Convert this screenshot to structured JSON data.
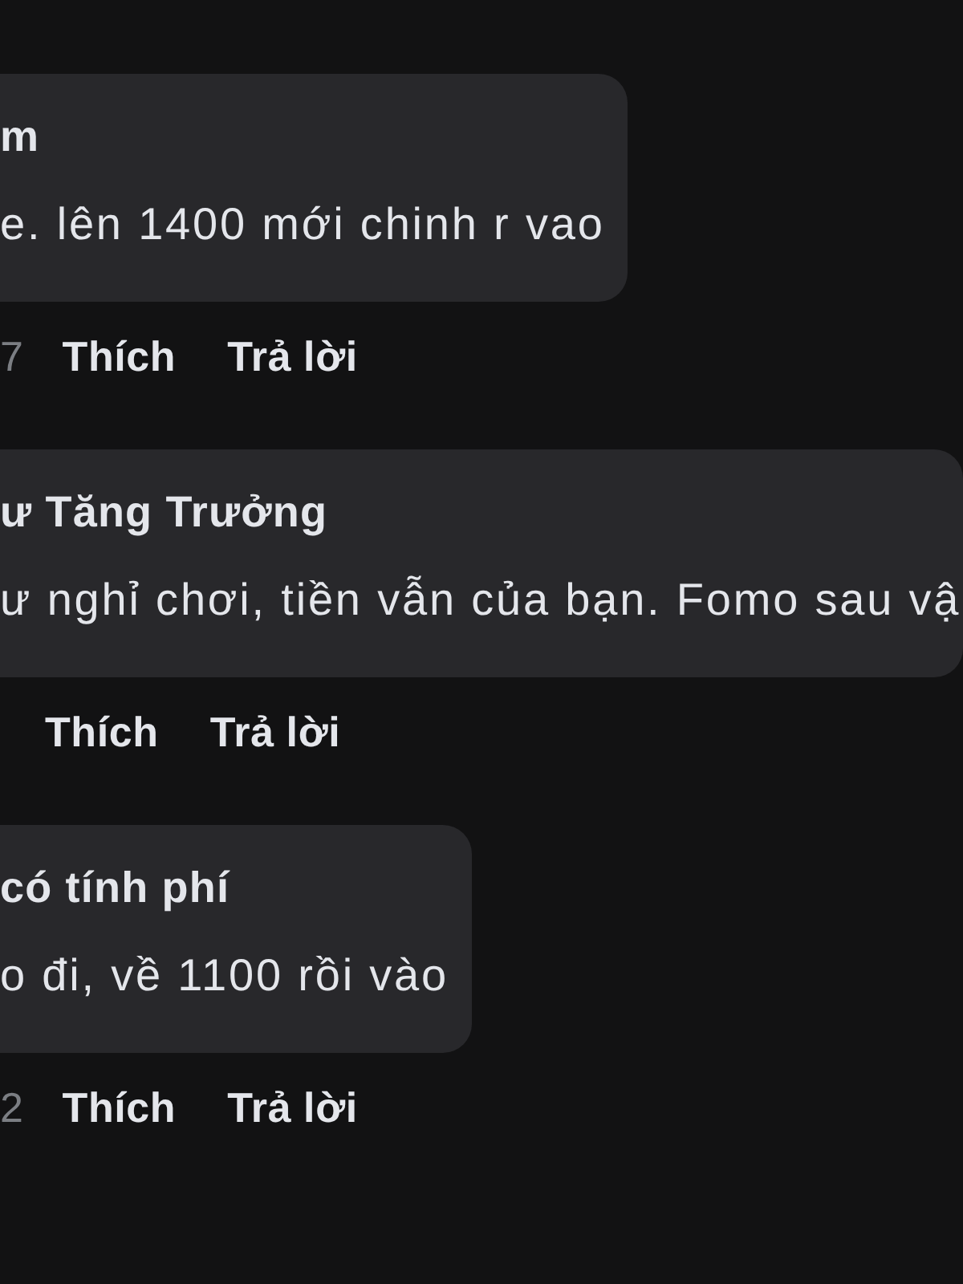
{
  "comments": [
    {
      "author": "m",
      "text": "e. lên 1400 mới chinh r vao",
      "time": "7",
      "like": "Thích",
      "reply": "Trả lời"
    },
    {
      "author": "ư Tăng Trưởng",
      "text": "ư nghỉ chơi, tiền vẫn của bạn. Fomo sau vậ",
      "like": "Thích",
      "reply": "Trả lời"
    },
    {
      "author": "có tính phí",
      "text": "o đi, về 1100 rồi vào",
      "time": "2",
      "like": "Thích",
      "reply": "Trả lời"
    }
  ]
}
